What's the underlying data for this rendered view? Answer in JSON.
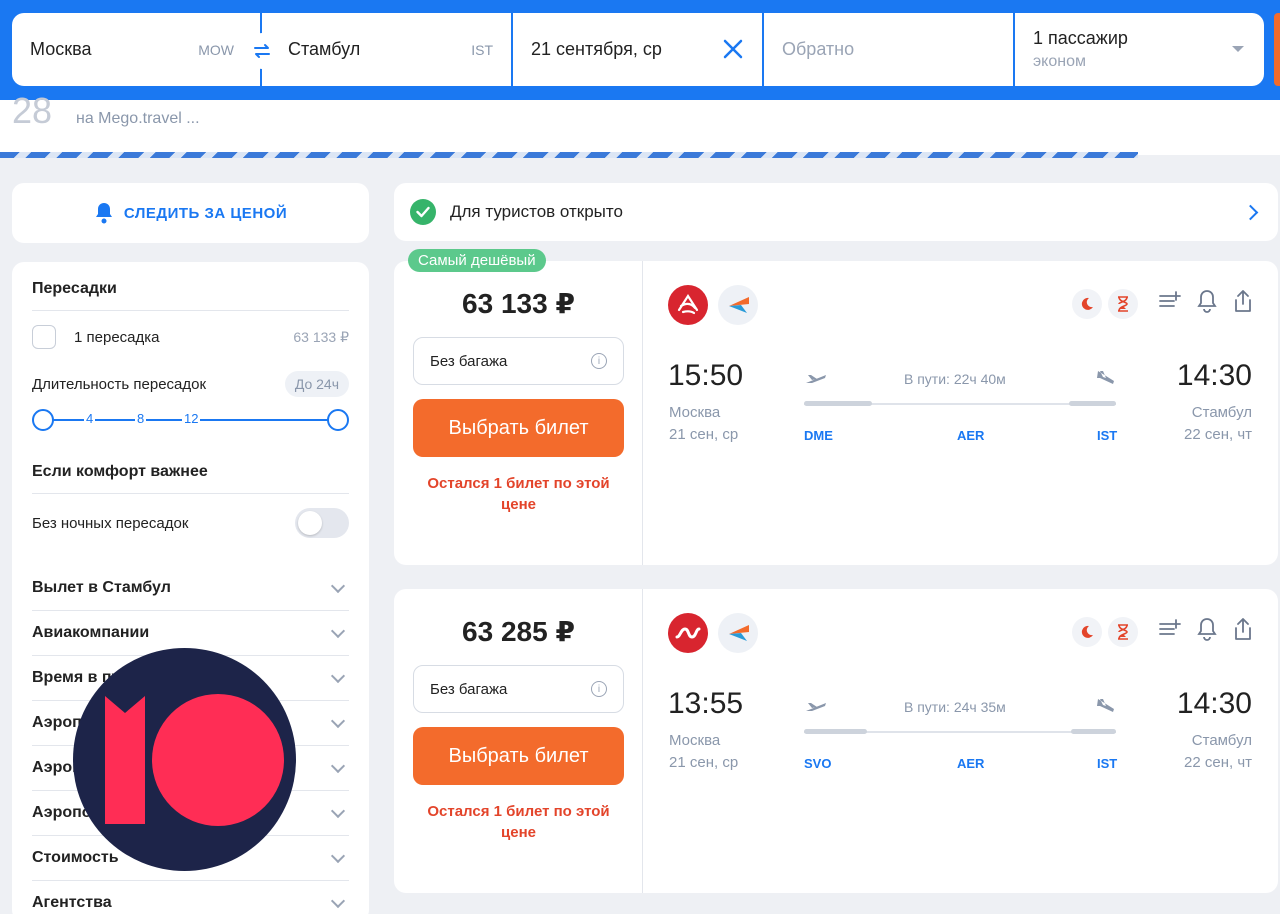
{
  "search": {
    "from_city": "Москва",
    "from_code": "MOW",
    "to_city": "Стамбул",
    "to_code": "IST",
    "depart_date": "21 сентября, ср",
    "return_placeholder": "Обратно",
    "passengers": "1 пассажир",
    "cabin_class": "эконом"
  },
  "progress": {
    "counter": "28",
    "message": "на Mego.travel ..."
  },
  "follow_price_label": "СЛЕДИТЬ ЗА ЦЕНОЙ",
  "filters": {
    "transfers_title": "Пересадки",
    "one_transfer_label": "1 пересадка",
    "one_transfer_price": "63 133 ₽",
    "duration_title": "Длительность пересадок",
    "duration_value": "До 24ч",
    "slider_ticks": [
      "4",
      "8",
      "12"
    ],
    "comfort_title": "Если комфорт важнее",
    "no_night_label": "Без ночных пересадок",
    "sections": [
      "Вылет в Стамбул",
      "Авиакомпании",
      "Время в пути",
      "Аэропорты вылета",
      "Аэропорты прилёта",
      "Аэропорты пересадок",
      "Стоимость",
      "Агентства"
    ]
  },
  "banner": {
    "text": "Для туристов открыто"
  },
  "tickets": [
    {
      "badge": "Самый дешёвый",
      "price": "63 133 ₽",
      "baggage": "Без багажа",
      "buy_label": "Выбрать билет",
      "warning": "Остался 1 билет по этой цене",
      "dep_time": "15:50",
      "dep_city": "Москва",
      "dep_date": "21 сен, ср",
      "arr_time": "14:30",
      "arr_city": "Стамбул",
      "arr_date": "22 сен, чт",
      "duration": "В пути: 22ч 40м",
      "airports": [
        "DME",
        "AER",
        "IST"
      ]
    },
    {
      "badge": "",
      "price": "63 285 ₽",
      "baggage": "Без багажа",
      "buy_label": "Выбрать билет",
      "warning": "Остался 1 билет по этой цене",
      "dep_time": "13:55",
      "dep_city": "Москва",
      "dep_date": "21 сен, ср",
      "arr_time": "14:30",
      "arr_city": "Стамбул",
      "arr_date": "22 сен, чт",
      "duration": "В пути: 24ч 35м",
      "airports": [
        "SVO",
        "AER",
        "IST"
      ]
    }
  ],
  "colors": {
    "brand_blue": "#1a78f2",
    "cta_orange": "#f36b2c",
    "warning_red": "#e3442a",
    "success_green": "#36b46a"
  }
}
